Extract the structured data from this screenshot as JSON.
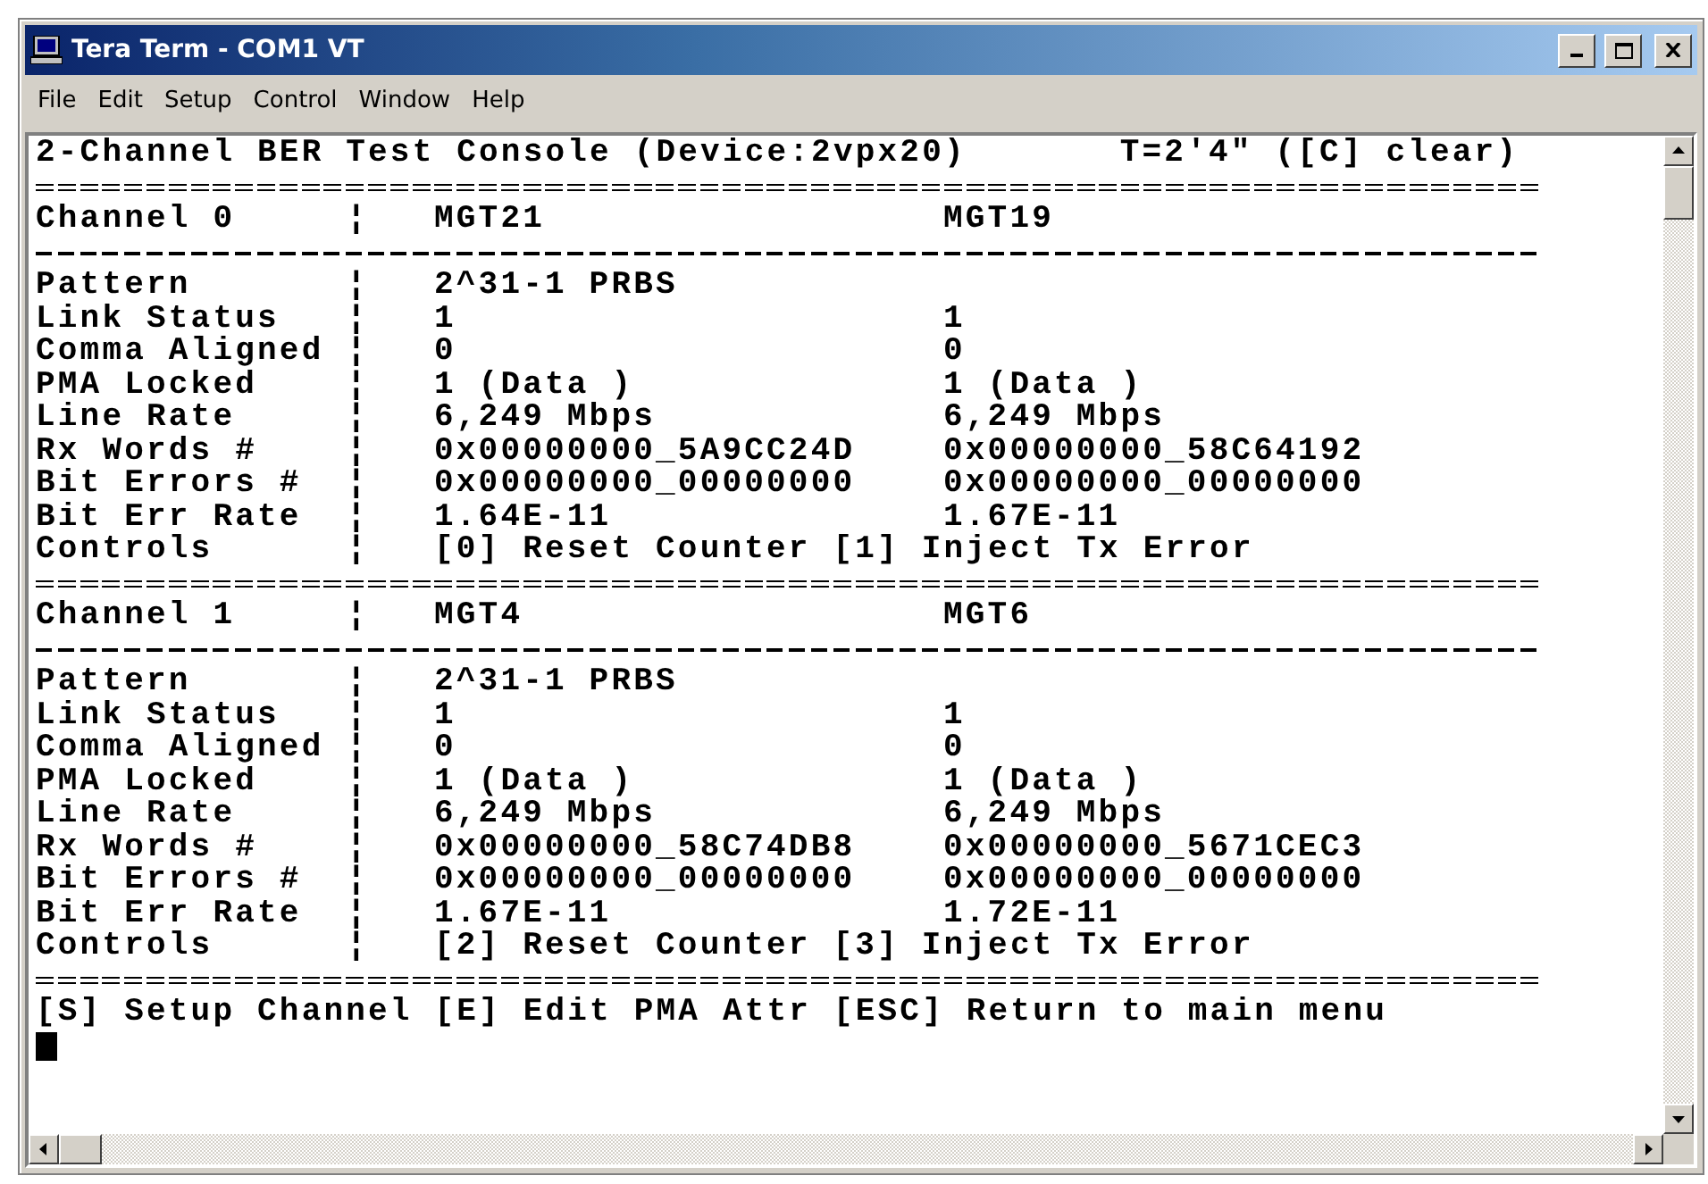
{
  "window": {
    "title": "Tera Term - COM1 VT"
  },
  "menu": [
    "File",
    "Edit",
    "Setup",
    "Control",
    "Window",
    "Help"
  ],
  "terminal": {
    "header": {
      "title": "2-Channel BER Test Console (Device:2vpx20)",
      "timer": "T=2'4\" ([C] clear)"
    },
    "channels": [
      {
        "label": "Channel 0",
        "separator": "¦",
        "lanes": [
          "MGT21",
          "MGT19"
        ],
        "rows": [
          {
            "label": "Pattern",
            "separator": "¦",
            "values": [
              "2^31-1 PRBS"
            ]
          },
          {
            "label": "Link Status",
            "separator": "¦",
            "values": [
              "1",
              "1"
            ]
          },
          {
            "label": "Comma Aligned",
            "separator": "¦",
            "values": [
              "0",
              "0"
            ]
          },
          {
            "label": "PMA Locked",
            "separator": "¦",
            "values": [
              "1 (Data )",
              "1 (Data )"
            ]
          },
          {
            "label": "Line Rate",
            "separator": "¦",
            "values": [
              "6,249 Mbps",
              "6,249 Mbps"
            ]
          },
          {
            "label": "Rx Words #",
            "separator": "¦",
            "values": [
              "0x00000000_5A9CC24D",
              "0x00000000_58C64192"
            ]
          },
          {
            "label": "Bit Errors #",
            "separator": "¦",
            "values": [
              "0x00000000_00000000",
              "0x00000000_00000000"
            ]
          },
          {
            "label": "Bit Err Rate",
            "separator": "¦",
            "values": [
              "1.64E-11",
              "1.67E-11"
            ]
          },
          {
            "label": "Controls",
            "separator": "¦",
            "values": [
              "[0] Reset Counter [1] Inject Tx Error"
            ]
          }
        ]
      },
      {
        "label": "Channel 1",
        "separator": "¦",
        "lanes": [
          "MGT4",
          "MGT6"
        ],
        "rows": [
          {
            "label": "Pattern",
            "separator": "¦",
            "values": [
              "2^31-1 PRBS"
            ]
          },
          {
            "label": "Link Status",
            "separator": "¦",
            "values": [
              "1",
              "1"
            ]
          },
          {
            "label": "Comma Aligned",
            "separator": "¦",
            "values": [
              "0",
              "0"
            ]
          },
          {
            "label": "PMA Locked",
            "separator": "¦",
            "values": [
              "1 (Data )",
              "1 (Data )"
            ]
          },
          {
            "label": "Line Rate",
            "separator": "¦",
            "values": [
              "6,249 Mbps",
              "6,249 Mbps"
            ]
          },
          {
            "label": "Rx Words #",
            "separator": "¦",
            "values": [
              "0x00000000_58C74DB8",
              "0x00000000_5671CEC3"
            ]
          },
          {
            "label": "Bit Errors #",
            "separator": "¦",
            "values": [
              "0x00000000_00000000",
              "0x00000000_00000000"
            ]
          },
          {
            "label": "Bit Err Rate",
            "separator": "¦",
            "values": [
              "1.67E-11",
              "1.72E-11"
            ]
          },
          {
            "label": "Controls",
            "separator": "¦",
            "values": [
              "[2] Reset Counter [3] Inject Tx Error"
            ]
          }
        ]
      }
    ],
    "footer": "[S] Setup Channel [E] Edit PMA Attr [ESC] Return to main menu"
  }
}
